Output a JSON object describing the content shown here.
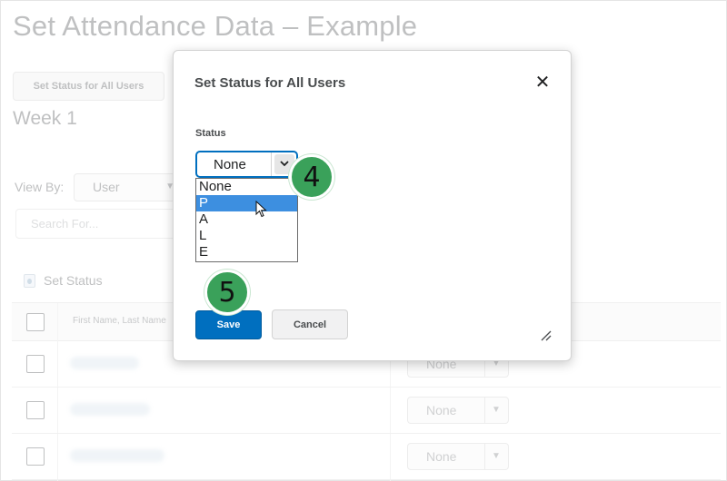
{
  "page": {
    "title": "Set Attendance Data – Example",
    "set_status_all_label": "Set Status for All Users",
    "week_title": "Week 1",
    "view_by_label": "View By:",
    "view_by_value": "User",
    "search_placeholder": "Search For...",
    "set_status_label": "Set Status",
    "table": {
      "name_header": "First Name, Last Name",
      "rows": [
        {
          "status": "None"
        },
        {
          "status": "None"
        },
        {
          "status": "None"
        }
      ]
    }
  },
  "modal": {
    "title": "Set Status for All Users",
    "close_glyph": "✕",
    "status_label": "Status",
    "selected_value": "None",
    "options": [
      "None",
      "P",
      "A",
      "L",
      "E"
    ],
    "highlighted_option": "P",
    "save_label": "Save",
    "cancel_label": "Cancel"
  },
  "annotations": {
    "step_4": "4",
    "step_5": "5",
    "badge_color": "#3aa15a"
  },
  "colors": {
    "primary": "#006fbf",
    "option_highlight": "#3d8fe0"
  }
}
